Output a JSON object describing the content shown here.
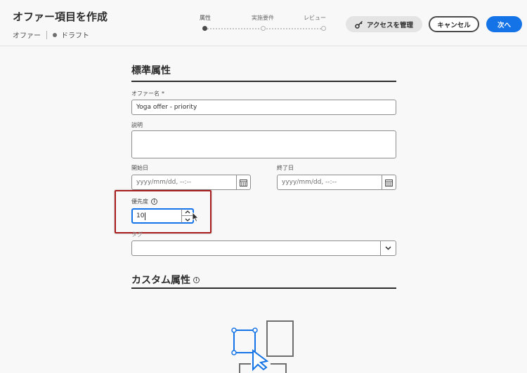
{
  "header": {
    "title": "オファー項目を作成",
    "breadcrumb_offer": "オファー",
    "breadcrumb_status": "ドラフト"
  },
  "stepper": {
    "steps": [
      "属性",
      "実施要件",
      "レビュー"
    ],
    "active_index": 0
  },
  "actions": {
    "manage_access": "アクセスを管理",
    "cancel": "キャンセル",
    "next": "次へ"
  },
  "standard_attributes": {
    "title": "標準属性",
    "offer_name_label": "オファー名",
    "required_mark": "*",
    "offer_name_value": "Yoga offer - priority",
    "description_label": "説明",
    "description_value": "",
    "start_date_label": "開始日",
    "start_date_placeholder": "yyyy/mm/dd, --:--",
    "end_date_label": "終了日",
    "end_date_placeholder": "yyyy/mm/dd, --:--",
    "priority_label": "優先度",
    "priority_value": "10",
    "tags_label": "タグ",
    "tags_value": ""
  },
  "custom_attributes": {
    "title": "カスタム属性"
  },
  "colors": {
    "accent": "#1473e6",
    "highlight": "#a81e1e",
    "text": "#2c2c2c"
  }
}
